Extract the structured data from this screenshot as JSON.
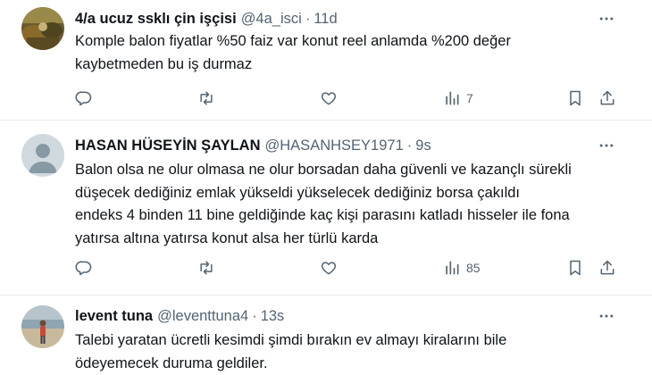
{
  "tweets": [
    {
      "name": "4/a ucuz ssklı çin işçisi",
      "handle": "@4a_isci",
      "time": "11d",
      "avatar_icon": "photo-avatar",
      "lines": [
        "Komple balon fiyatlar %50 faiz var konut reel anlamda %200 değer",
        "kaybetmeden bu iş durmaz"
      ],
      "views": "7"
    },
    {
      "name": "HASAN HÜSEYİN ŞAYLAN",
      "handle": "@HASANHSEY1971",
      "time": "9s",
      "avatar_icon": "default-profile-avatar",
      "lines": [
        "Balon olsa ne olur olmasa ne olur borsadan daha güvenli ve kazançlı sürekli",
        "düşecek dediğiniz emlak yükseldi yükselecek dediğiniz borsa çakıldı",
        "endeks 4 binden 11 bine geldiğinde kaç kişi parasını katladı hisseler ile fona",
        "yatırsa altına yatırsa konut alsa her türlü karda"
      ],
      "views": "85"
    },
    {
      "name": "levent tuna",
      "handle": "@leventtuna4",
      "time": "13s",
      "avatar_icon": "beach-photo-avatar",
      "lines": [
        "Talebi yaratan ücretli kesimdi şimdi bırakın ev almayı kiralarını bile",
        "ödeyemecek duruma geldiler."
      ]
    }
  ],
  "separator": "·",
  "icons": {
    "reply": "reply-icon",
    "retweet": "retweet-icon",
    "like": "heart-icon",
    "views": "views-chart-icon",
    "bookmark": "bookmark-icon",
    "share": "share-icon",
    "more": "more-dots-icon"
  },
  "colors": {
    "text": "#0f1419",
    "secondary": "#536471",
    "divider": "#e6ecf0"
  }
}
